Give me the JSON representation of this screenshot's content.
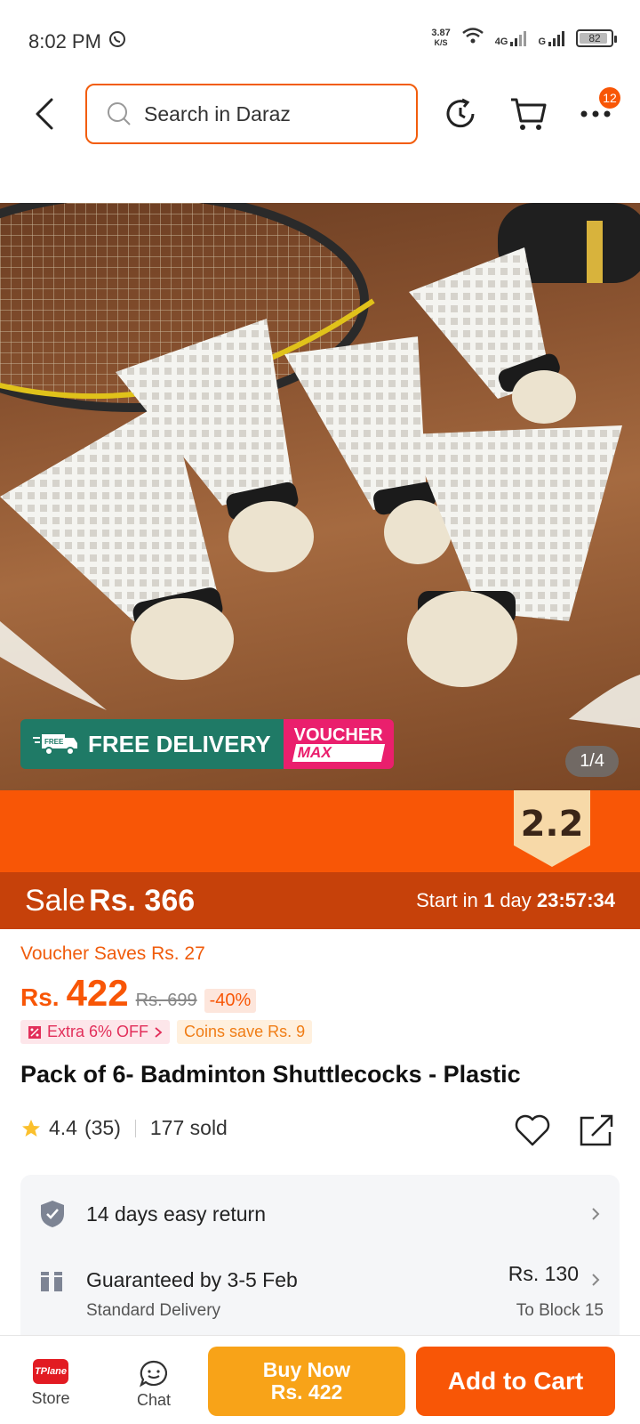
{
  "status_bar": {
    "time": "8:02 PM",
    "net_speed_value": "3.87",
    "net_speed_unit": "K/S",
    "network_4g": "4G",
    "network_g": "G",
    "battery": "82"
  },
  "header": {
    "search_placeholder": "Search in Daraz",
    "more_badge": "12"
  },
  "product_image": {
    "badge_left": "FREE DELIVERY",
    "badge_free_small": "FREE",
    "badge_right_line1": "VOUCHER",
    "badge_right_line2": "MAX",
    "counter": "1/4"
  },
  "sale_banner": {
    "tag": "2.2",
    "sale_label": "Sale",
    "sale_price": "Rs. 366",
    "countdown_prefix": "Start in",
    "countdown_days": "1",
    "countdown_day_word": "day",
    "countdown_time": "23:57:34"
  },
  "pricing": {
    "voucher_saves": "Voucher Saves Rs. 27",
    "currency": "Rs.",
    "price": "422",
    "original_price": "Rs. 699",
    "discount": "-40%",
    "extra_off": "Extra 6% OFF",
    "coins_save": "Coins save Rs. 9"
  },
  "product": {
    "title": "Pack of 6- Badminton Shuttlecocks - Plastic",
    "rating": "4.4",
    "rating_count": "(35)",
    "sold": "177 sold"
  },
  "service": {
    "return_label": "14 days easy return",
    "delivery_label": "Guaranteed by 3-5 Feb",
    "delivery_type": "Standard Delivery",
    "delivery_price": "Rs. 130",
    "delivery_to": "To Block 15"
  },
  "bottom_bar": {
    "store_label": "Store",
    "store_logo_text": "TPlane",
    "chat_label": "Chat",
    "buy_now_label": "Buy Now",
    "buy_now_price": "Rs. 422",
    "add_to_cart_label": "Add to Cart"
  },
  "colors": {
    "brand_orange": "#f85606",
    "sale_dark": "#c6410a",
    "buy_now_yellow": "#f8a318",
    "free_delivery_green": "#1f7a66",
    "voucher_pink": "#ea1f6d"
  }
}
